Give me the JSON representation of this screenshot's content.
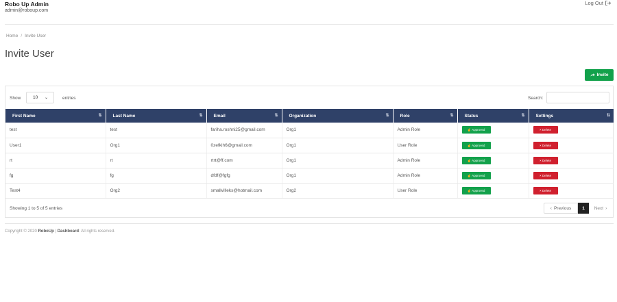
{
  "header": {
    "brand_title": "Robo Up Admin",
    "brand_email": "admin@roboup.com",
    "logout_label": "Log Out"
  },
  "breadcrumb": {
    "home": "Home",
    "separator": "/",
    "current": "Invite User"
  },
  "page_title": "Invite User",
  "invite_button": {
    "icon": "share-arrow-icon",
    "label": "Invite"
  },
  "table_controls": {
    "show_label": "Show",
    "length_value": "10",
    "entries_label": "entries",
    "search_label": "Search:",
    "search_value": ""
  },
  "columns": [
    "First Name",
    "Last Name",
    "Email",
    "Organization",
    "Role",
    "Status",
    "Settings"
  ],
  "rows": [
    {
      "first_name": "test",
      "last_name": "test",
      "email": "fariha.roshni25@gmail.com",
      "organization": "Org1",
      "role": "Admin Role",
      "status": "Approved",
      "action": "Delete"
    },
    {
      "first_name": "User1",
      "last_name": "Org1",
      "email": "0zefkih6@gmail.com",
      "organization": "Org1",
      "role": "User Role",
      "status": "Approved",
      "action": "Delete"
    },
    {
      "first_name": "rt",
      "last_name": "rt",
      "email": "rtrt@ff.com",
      "organization": "Org1",
      "role": "Admin Role",
      "status": "Approved",
      "action": "Delete"
    },
    {
      "first_name": "fg",
      "last_name": "fg",
      "email": "dfdf@fgfg",
      "organization": "Org1",
      "role": "Admin Role",
      "status": "Approved",
      "action": "Delete"
    },
    {
      "first_name": "Test4",
      "last_name": "Org2",
      "email": "smallvilleks@hotmail.com",
      "organization": "Org2",
      "role": "User Role",
      "status": "Approved",
      "action": "Delete"
    }
  ],
  "pagination": {
    "info": "Showing 1 to 5 of 5 entries",
    "previous": "Previous",
    "current_page": "1",
    "next": "Next"
  },
  "footer": {
    "prefix": "Copyright © 2020 ",
    "brand": "RoboUp",
    "separator": " | ",
    "product": "Dashboard",
    "suffix": ": All rights reserved."
  },
  "colors": {
    "table_header": "#2f4168",
    "approved": "#12a14b",
    "delete": "#d0202e",
    "invite": "#12a14b"
  }
}
